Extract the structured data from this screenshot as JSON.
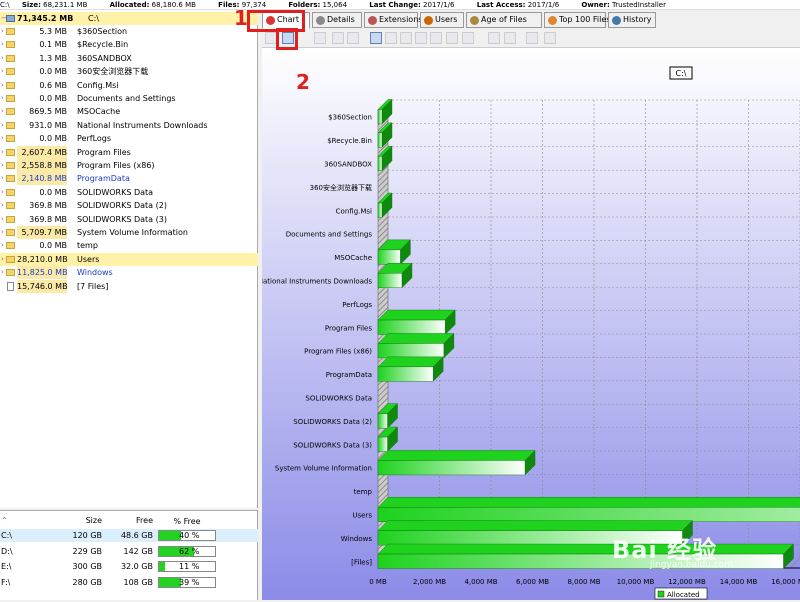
{
  "topbar": {
    "path": "C:\\",
    "size_label": "Size:",
    "size_value": "68,231.1 MB",
    "allocated_label": "Allocated:",
    "allocated_value": "68,180.6 MB",
    "files_label": "Files:",
    "files_value": "97,374",
    "folders_label": "Folders:",
    "folders_value": "15,064",
    "last_change_label": "Last Change:",
    "last_change_value": "2017/1/6",
    "last_access_label": "Last Access:",
    "last_access_value": "2017/1/6",
    "owner_label": "Owner:",
    "owner_value": "TrustedInstaller"
  },
  "tree": {
    "root": {
      "size": "71,345.2 MB",
      "name": "C:\\"
    },
    "items": [
      {
        "size": "5.3 MB",
        "name": "$360Section",
        "hl": false,
        "blue": false,
        "type": "folder"
      },
      {
        "size": "0.1 MB",
        "name": "$Recycle.Bin",
        "hl": false,
        "blue": false,
        "type": "folder"
      },
      {
        "size": "1.3 MB",
        "name": "360SANDBOX",
        "hl": false,
        "blue": false,
        "type": "folder"
      },
      {
        "size": "0.0 MB",
        "name": "360安全浏览器下载",
        "hl": false,
        "blue": false,
        "type": "folder"
      },
      {
        "size": "0.6 MB",
        "name": "Config.Msi",
        "hl": false,
        "blue": false,
        "type": "folder"
      },
      {
        "size": "0.0 MB",
        "name": "Documents and Settings",
        "hl": false,
        "blue": false,
        "type": "link"
      },
      {
        "size": "869.5 MB",
        "name": "MSOCache",
        "hl": false,
        "blue": false,
        "type": "folder"
      },
      {
        "size": "931.0 MB",
        "name": "National Instruments Downloads",
        "hl": false,
        "blue": false,
        "type": "folder"
      },
      {
        "size": "0.0 MB",
        "name": "PerfLogs",
        "hl": false,
        "blue": false,
        "type": "folder"
      },
      {
        "size": "2,607.4 MB",
        "name": "Program Files",
        "hl": true,
        "blue": false,
        "type": "folder"
      },
      {
        "size": "2,558.8 MB",
        "name": "Program Files (x86)",
        "hl": true,
        "blue": false,
        "type": "folder"
      },
      {
        "size": "2,140.8 MB",
        "name": "ProgramData",
        "hl": true,
        "blue": true,
        "type": "folder"
      },
      {
        "size": "0.0 MB",
        "name": "SOLIDWORKS Data",
        "hl": false,
        "blue": false,
        "type": "folder"
      },
      {
        "size": "369.8 MB",
        "name": "SOLIDWORKS Data (2)",
        "hl": false,
        "blue": false,
        "type": "folder"
      },
      {
        "size": "369.8 MB",
        "name": "SOLIDWORKS Data (3)",
        "hl": false,
        "blue": false,
        "type": "folder"
      },
      {
        "size": "5,709.7 MB",
        "name": "System Volume Information",
        "hl": true,
        "blue": false,
        "type": "folder"
      },
      {
        "size": "0.0 MB",
        "name": "temp",
        "hl": false,
        "blue": false,
        "type": "folder"
      },
      {
        "size": "28,210.0 MB",
        "name": "Users",
        "hl": true,
        "blue": false,
        "sel": true,
        "type": "folder"
      },
      {
        "size": "11,825.0 MB",
        "name": "Windows",
        "hl": true,
        "blue": true,
        "type": "folder"
      },
      {
        "size": "15,746.0 MB",
        "name": "[7 Files]",
        "hl": true,
        "blue": false,
        "type": "file"
      }
    ]
  },
  "drives": {
    "headers": {
      "size": "Size",
      "free": "Free",
      "pct": "% Free"
    },
    "rows": [
      {
        "name": "C:\\",
        "size": "120 GB",
        "free": "48.6 GB",
        "pct": "40 %",
        "pct_value": 40,
        "sel": true
      },
      {
        "name": "D:\\",
        "size": "229 GB",
        "free": "142 GB",
        "pct": "62 %",
        "pct_value": 62,
        "sel": false
      },
      {
        "name": "E:\\",
        "size": "300 GB",
        "free": "32.0 GB",
        "pct": "11 %",
        "pct_value": 11,
        "sel": false
      },
      {
        "name": "F:\\",
        "size": "280 GB",
        "free": "108 GB",
        "pct": "39 %",
        "pct_value": 39,
        "sel": false
      }
    ]
  },
  "tabs": [
    {
      "label": "Chart",
      "icon": "pie-chart-icon",
      "color": "#d33",
      "active": true
    },
    {
      "label": "Details",
      "icon": "details-icon",
      "color": "#888",
      "active": false
    },
    {
      "label": "Extensions",
      "icon": "extensions-icon",
      "color": "#b55",
      "active": false
    },
    {
      "label": "Users",
      "icon": "users-icon",
      "color": "#c60",
      "active": false
    },
    {
      "label": "Age of Files",
      "icon": "age-icon",
      "color": "#a84",
      "active": false
    },
    {
      "label": "Top 100 Files",
      "icon": "top-files-icon",
      "color": "#d83",
      "active": false
    },
    {
      "label": "History",
      "icon": "history-icon",
      "color": "#47a",
      "active": false
    }
  ],
  "annotations": {
    "one": "1",
    "two": "2"
  },
  "watermark": {
    "text": "Bai 经验",
    "sub": "jingyan.baidu.com"
  },
  "chart_data": {
    "type": "bar",
    "title": "C:\\",
    "orientation": "horizontal",
    "categories": [
      "$360Section",
      "$Recycle.Bin",
      "360SANDBOX",
      "360安全浏览器下载",
      "Config.Msi",
      "Documents and Settings",
      "MSOCache",
      "National Instruments Downloads",
      "PerfLogs",
      "Program Files",
      "Program Files (x86)",
      "ProgramData",
      "SOLIDWORKS Data",
      "SOLIDWORKS Data (2)",
      "SOLIDWORKS Data (3)",
      "System Volume Information",
      "temp",
      "Users",
      "Windows",
      "[Files]"
    ],
    "series": [
      {
        "name": "Allocated",
        "values": [
          5.3,
          0.1,
          1.3,
          0.0,
          0.6,
          0.0,
          869.5,
          931.0,
          0.0,
          2607.4,
          2558.8,
          2140.8,
          0.0,
          369.8,
          369.8,
          5709.7,
          0.0,
          28210.0,
          11825.0,
          15746.0
        ]
      }
    ],
    "xlim": [
      0,
      16000
    ],
    "xticks": [
      "0 MB",
      "2,000 MB",
      "4,000 MB",
      "6,000 MB",
      "8,000 MB",
      "10,000 MB",
      "12,000 MB",
      "14,000 MB",
      "16,000 MB"
    ],
    "colors": {
      "background_top": "#ffffff",
      "background_bottom": "#8b8be8",
      "bar": "#1ed21e",
      "bar_dark": "#0f8a0f"
    },
    "grid": true,
    "legend_position": "bottom"
  }
}
